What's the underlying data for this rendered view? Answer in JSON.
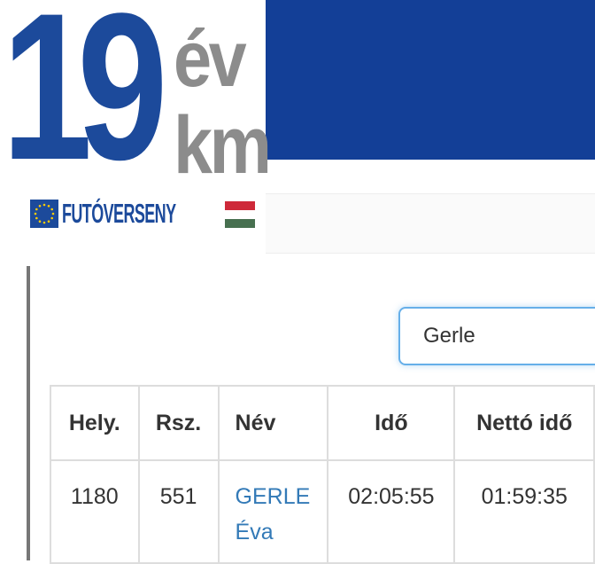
{
  "logo": {
    "number": "19",
    "unit_top": "év",
    "unit_bottom": "km",
    "tagline": "FUTÓVERSENY",
    "eu_flag_icon": "eu-flag-icon",
    "hu_flag_icon": "hungarian-flag-icon",
    "colors": {
      "blue": "#1c4a9b",
      "grey": "#8c8c8c",
      "hu_red": "#ce2939",
      "hu_green": "#477050"
    }
  },
  "header": {
    "band_color": "#133f97"
  },
  "search": {
    "value": "Gerle",
    "placeholder": ""
  },
  "results": {
    "columns": [
      "Hely.",
      "Rsz.",
      "Név",
      "Idő",
      "Nettó idő"
    ],
    "rows": [
      {
        "place": "1180",
        "bib": "551",
        "name_line1": "GERLE",
        "name_line2": "Éva",
        "time": "02:05:55",
        "net_time": "01:59:35"
      }
    ]
  }
}
